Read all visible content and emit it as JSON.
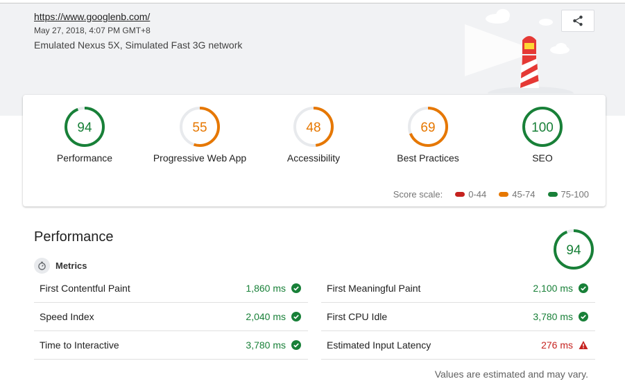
{
  "report": {
    "url": "https://www.googlenb.com/",
    "date": "May 27, 2018, 4:07 PM GMT+8",
    "environment": "Emulated Nexus 5X, Simulated Fast 3G network",
    "share_icon": "share-icon"
  },
  "colors": {
    "pass": "#188038",
    "average": "#e67700",
    "fail": "#c5221f",
    "track": "#e8eaed"
  },
  "gauges": [
    {
      "score": 94,
      "label": "Performance",
      "rating": "pass"
    },
    {
      "score": 55,
      "label": "Progressive Web App",
      "rating": "average"
    },
    {
      "score": 48,
      "label": "Accessibility",
      "rating": "average"
    },
    {
      "score": 69,
      "label": "Best Practices",
      "rating": "average"
    },
    {
      "score": 100,
      "label": "SEO",
      "rating": "pass"
    }
  ],
  "scale": {
    "label": "Score scale:",
    "fail_range": "0-44",
    "average_range": "45-74",
    "pass_range": "75-100"
  },
  "performance": {
    "title": "Performance",
    "score": 94,
    "metrics_label": "Metrics",
    "metrics_icon": "stopwatch-icon",
    "left_metrics": [
      {
        "name": "First Contentful Paint",
        "value": "1,860 ms",
        "status": "pass"
      },
      {
        "name": "Speed Index",
        "value": "2,040 ms",
        "status": "pass"
      },
      {
        "name": "Time to Interactive",
        "value": "3,780 ms",
        "status": "pass"
      }
    ],
    "right_metrics": [
      {
        "name": "First Meaningful Paint",
        "value": "2,100 ms",
        "status": "pass"
      },
      {
        "name": "First CPU Idle",
        "value": "3,780 ms",
        "status": "pass"
      },
      {
        "name": "Estimated Input Latency",
        "value": "276 ms",
        "status": "fail"
      }
    ],
    "footnote": "Values are estimated and may vary."
  }
}
